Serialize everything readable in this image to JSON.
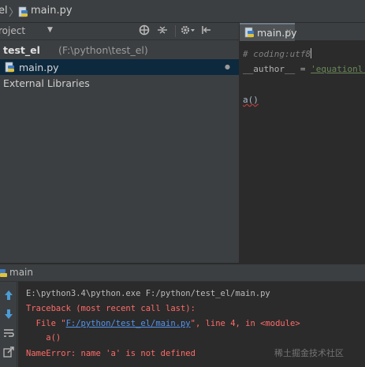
{
  "navbar": {
    "project_crumb": "el",
    "separator": "〉",
    "file_crumb": "main.py"
  },
  "project_panel": {
    "title": "roject",
    "dropdown_icon": "caret-down-icon",
    "toolbar_icons": [
      "target-icon",
      "collapse-all-icon",
      "gear-icon",
      "hide-panel-icon"
    ]
  },
  "tree": {
    "root": {
      "name": "test_el",
      "path": "(F:\\python\\test_el)"
    },
    "file": {
      "name": "main.py"
    },
    "external": "External Libraries"
  },
  "editor": {
    "tab": {
      "label": "main.py",
      "close": "×"
    },
    "lines": {
      "comment": "# coding:utf8",
      "author_name": "__author__",
      "author_eq": " = ",
      "author_val": "'equationl'",
      "call": "a()"
    }
  },
  "run": {
    "title": "main",
    "side_icons": [
      "arrow-up-icon",
      "arrow-down-icon",
      "soft-wrap-icon",
      "export-icon"
    ],
    "output": {
      "command": "E:\\python3.4\\python.exe F:/python/test_el/main.py",
      "traceback": "Traceback (most recent call last):",
      "file_prefix": "  File \"",
      "file_link": "F:/python/test_el/main.py",
      "file_suffix": "\", line 4, in <module>",
      "code": "    a()",
      "error": "NameError: name 'a' is not defined"
    }
  },
  "watermark": "稀土掘金技术社区",
  "colors": {
    "background": "#3c3f41",
    "editor_bg": "#2b2b2b",
    "selection": "#0d293e",
    "error_text": "#ff6b68",
    "link": "#5394ec",
    "string": "#6a8759"
  }
}
